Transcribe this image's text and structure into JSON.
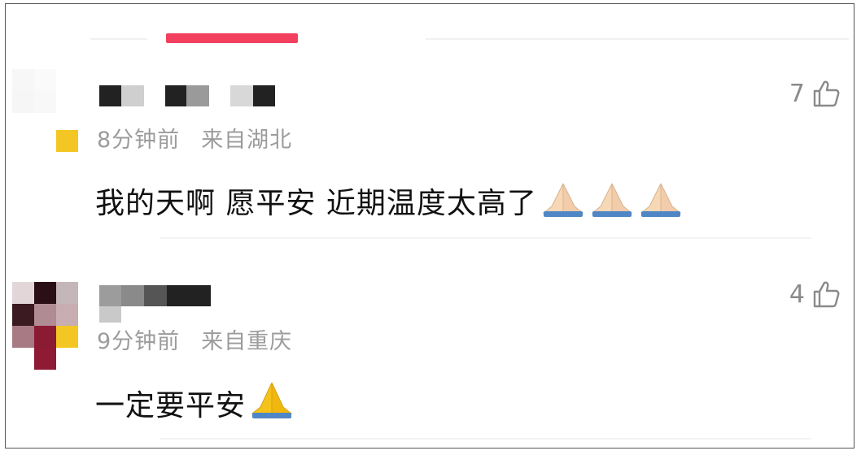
{
  "comments": [
    {
      "meta": {
        "time": "8分钟前",
        "location": "来自湖北"
      },
      "text": "我的天啊 愿平安 近期温度太高了",
      "emoji_count": 3,
      "likes": "7",
      "icons": {
        "like": "thumbs-up-outline-icon",
        "emoji": "folded-hands-emoji"
      }
    },
    {
      "meta": {
        "time": "9分钟前",
        "location": "来自重庆"
      },
      "text": "一定要平安",
      "emoji_count": 1,
      "likes": "4",
      "icons": {
        "like": "thumbs-up-outline-icon",
        "emoji": "folded-hands-emoji"
      }
    }
  ],
  "colors": {
    "accent": "#f2405e",
    "meta_text": "#9c9c9c",
    "body_text": "#111111"
  }
}
